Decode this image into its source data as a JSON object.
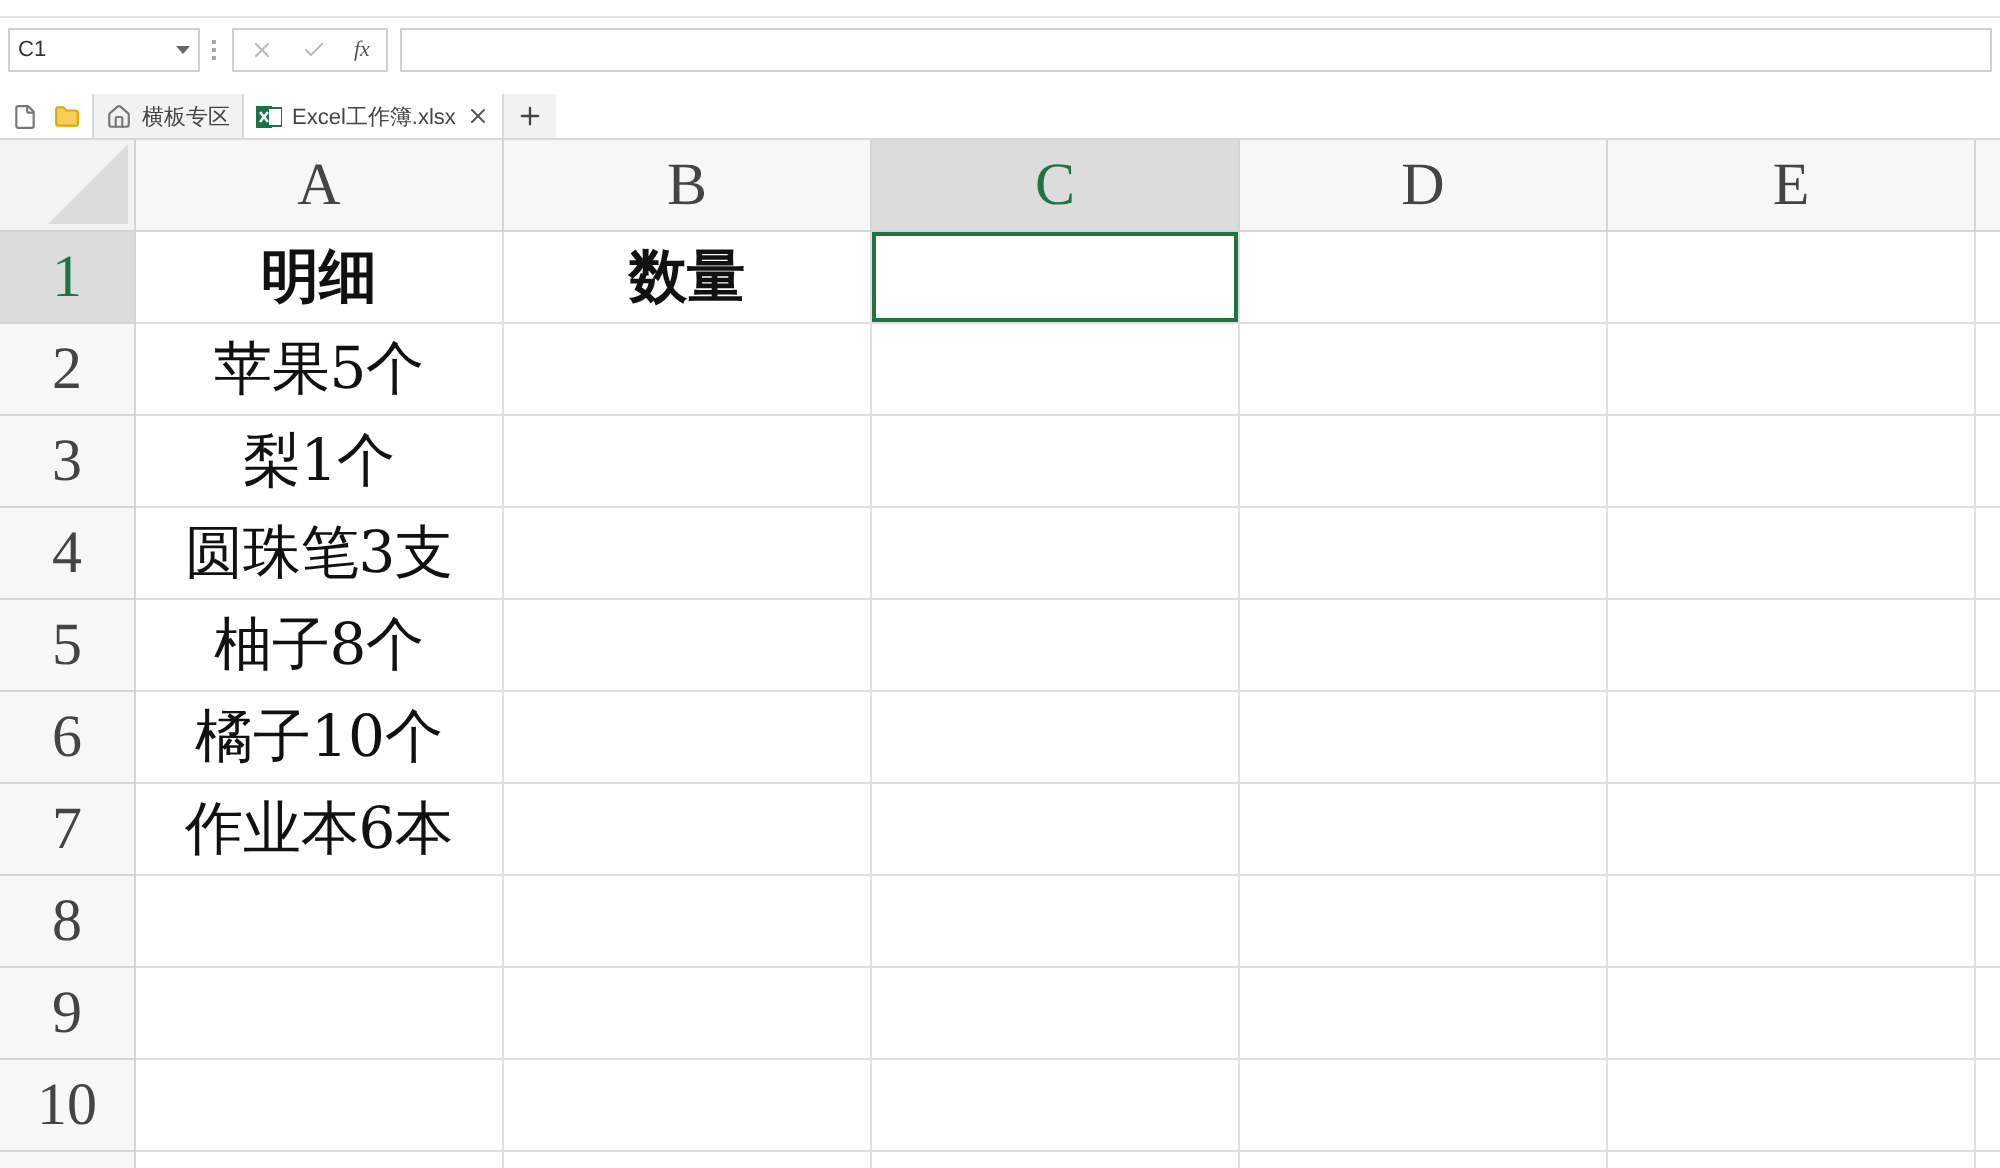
{
  "name_box": {
    "value": "C1"
  },
  "formula_bar": {
    "fx": "fx"
  },
  "tabs": [
    {
      "label": "横板专区",
      "kind": "home",
      "selected": false
    },
    {
      "label": "Excel工作簿.xlsx",
      "kind": "excel",
      "selected": true
    }
  ],
  "columns": [
    {
      "label": "A",
      "selected": false
    },
    {
      "label": "B",
      "selected": false
    },
    {
      "label": "C",
      "selected": true
    },
    {
      "label": "D",
      "selected": false
    },
    {
      "label": "E",
      "selected": false
    }
  ],
  "rows": [
    {
      "label": "1",
      "selected": true,
      "cells": [
        {
          "text": "明细",
          "selected": false
        },
        {
          "text": "数量",
          "selected": false
        },
        {
          "selected": true
        },
        {
          "selected": false
        },
        {
          "selected": false
        }
      ]
    },
    {
      "label": "2",
      "selected": false,
      "cells": [
        {
          "text": "苹果5个",
          "selected": false
        },
        {
          "selected": false
        },
        {
          "selected": false
        },
        {
          "selected": false
        },
        {
          "selected": false
        }
      ]
    },
    {
      "label": "3",
      "selected": false,
      "cells": [
        {
          "text": "梨1个",
          "selected": false
        },
        {
          "selected": false
        },
        {
          "selected": false
        },
        {
          "selected": false
        },
        {
          "selected": false
        }
      ]
    },
    {
      "label": "4",
      "selected": false,
      "cells": [
        {
          "text": "圆珠笔3支",
          "selected": false
        },
        {
          "selected": false
        },
        {
          "selected": false
        },
        {
          "selected": false
        },
        {
          "selected": false
        }
      ]
    },
    {
      "label": "5",
      "selected": false,
      "cells": [
        {
          "text": "柚子8个",
          "selected": false
        },
        {
          "selected": false
        },
        {
          "selected": false
        },
        {
          "selected": false
        },
        {
          "selected": false
        }
      ]
    },
    {
      "label": "6",
      "selected": false,
      "cells": [
        {
          "text": "橘子10个",
          "selected": false
        },
        {
          "selected": false
        },
        {
          "selected": false
        },
        {
          "selected": false
        },
        {
          "selected": false
        }
      ]
    },
    {
      "label": "7",
      "selected": false,
      "cells": [
        {
          "text": "作业本6本",
          "selected": false
        },
        {
          "selected": false
        },
        {
          "selected": false
        },
        {
          "selected": false
        },
        {
          "selected": false
        }
      ]
    },
    {
      "label": "8",
      "selected": false,
      "cells": [
        {
          "selected": false
        },
        {
          "selected": false
        },
        {
          "selected": false
        },
        {
          "selected": false
        },
        {
          "selected": false
        }
      ]
    },
    {
      "label": "9",
      "selected": false,
      "cells": [
        {
          "selected": false
        },
        {
          "selected": false
        },
        {
          "selected": false
        },
        {
          "selected": false
        },
        {
          "selected": false
        }
      ]
    },
    {
      "label": "10",
      "selected": false,
      "cells": [
        {
          "selected": false
        },
        {
          "selected": false
        },
        {
          "selected": false
        },
        {
          "selected": false
        },
        {
          "selected": false
        }
      ]
    }
  ]
}
